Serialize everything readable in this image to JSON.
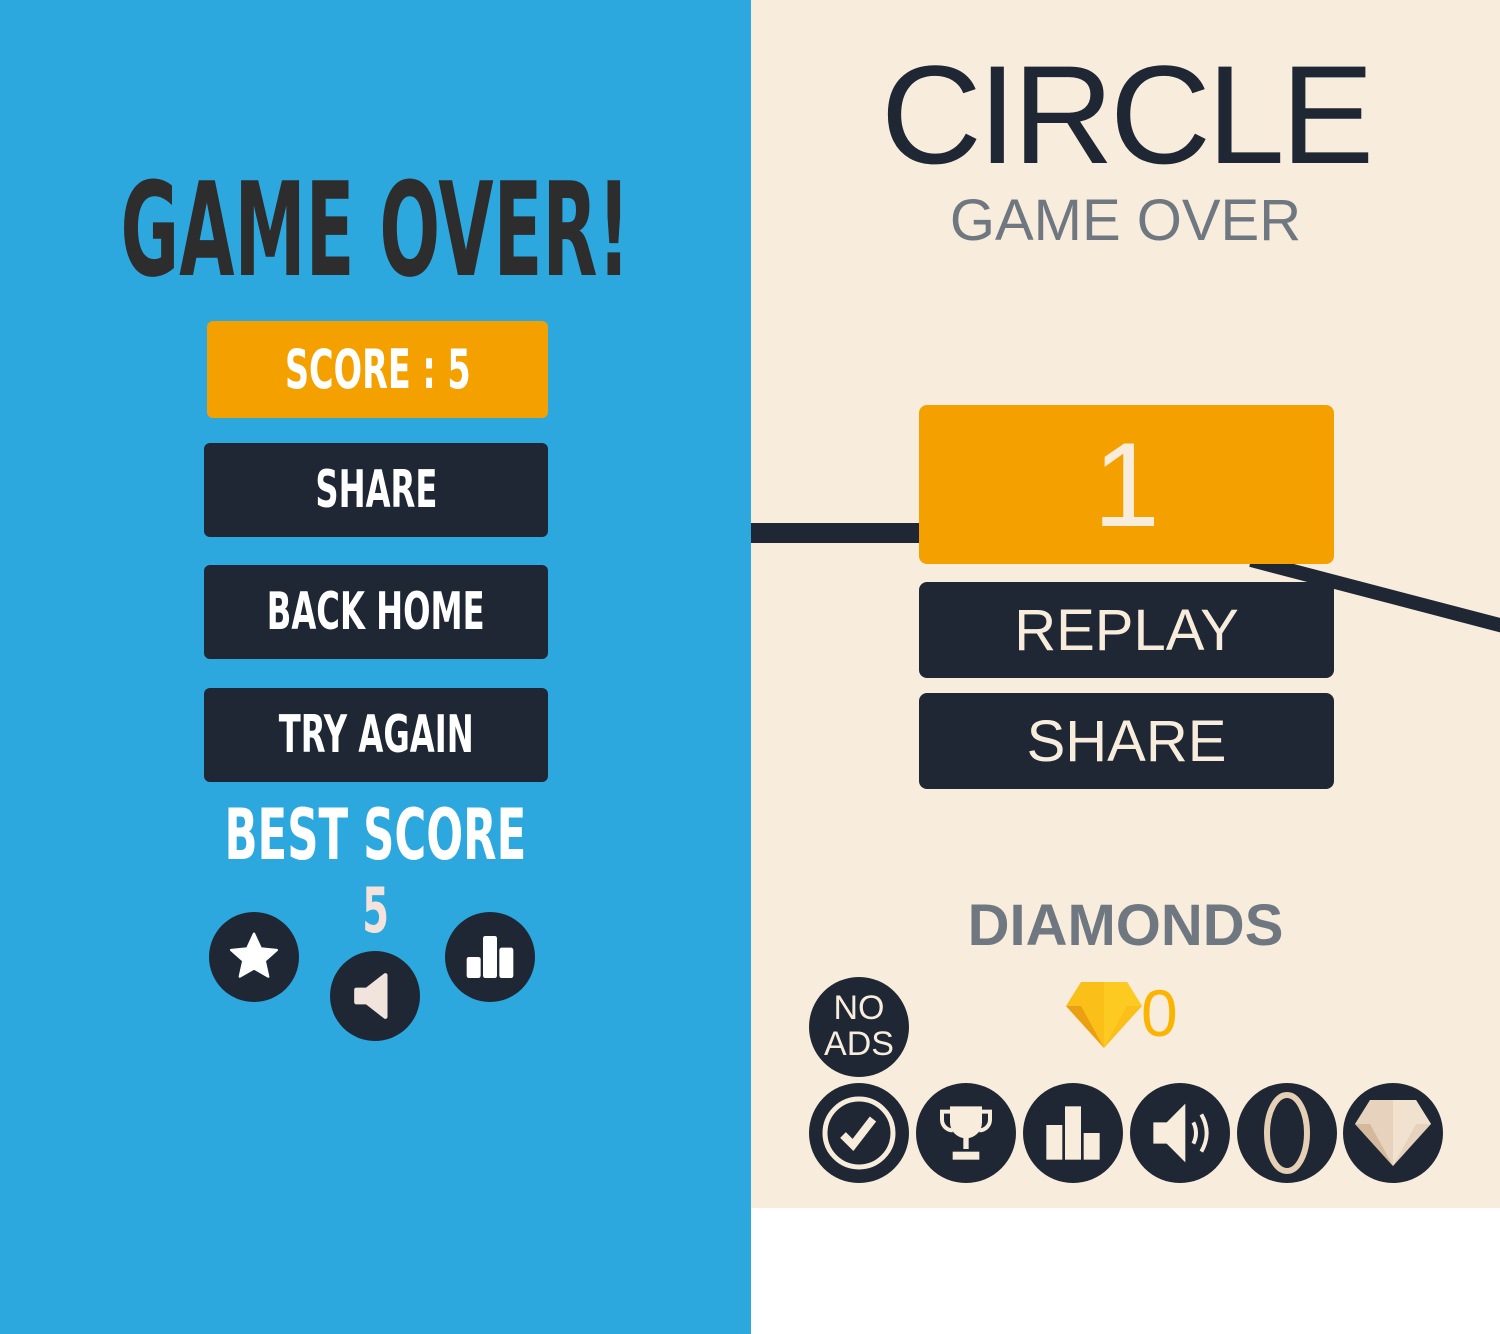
{
  "left_panel": {
    "title": "GAME OVER!",
    "score_label": "SCORE : 5",
    "buttons": [
      {
        "label": "SHARE"
      },
      {
        "label": "BACK HOME"
      },
      {
        "label": "TRY AGAIN"
      }
    ],
    "best_score_label": "BEST SCORE",
    "best_score_value": "5",
    "icons": [
      "star-icon",
      "sound-icon",
      "leaderboard-icon"
    ]
  },
  "right_panel": {
    "title": "CIRCLE",
    "subtitle": "GAME OVER",
    "score": "1",
    "buttons": [
      {
        "label": "REPLAY"
      },
      {
        "label": "SHARE"
      }
    ],
    "diamonds_label": "DIAMONDS",
    "diamonds_count": "0",
    "no_ads_label_1": "NO",
    "no_ads_label_2": "ADS",
    "icons": [
      "rate-check-icon",
      "trophy-icon",
      "leaderboard-icon",
      "sound-on-icon",
      "ring-icon",
      "diamond-icon"
    ]
  },
  "colors": {
    "blue": "#2ca8df",
    "orange": "#f4a100",
    "dark": "#1e2733",
    "cream": "#f8ecdc",
    "gray": "#6f7780",
    "gold": "#fbbf1a"
  }
}
